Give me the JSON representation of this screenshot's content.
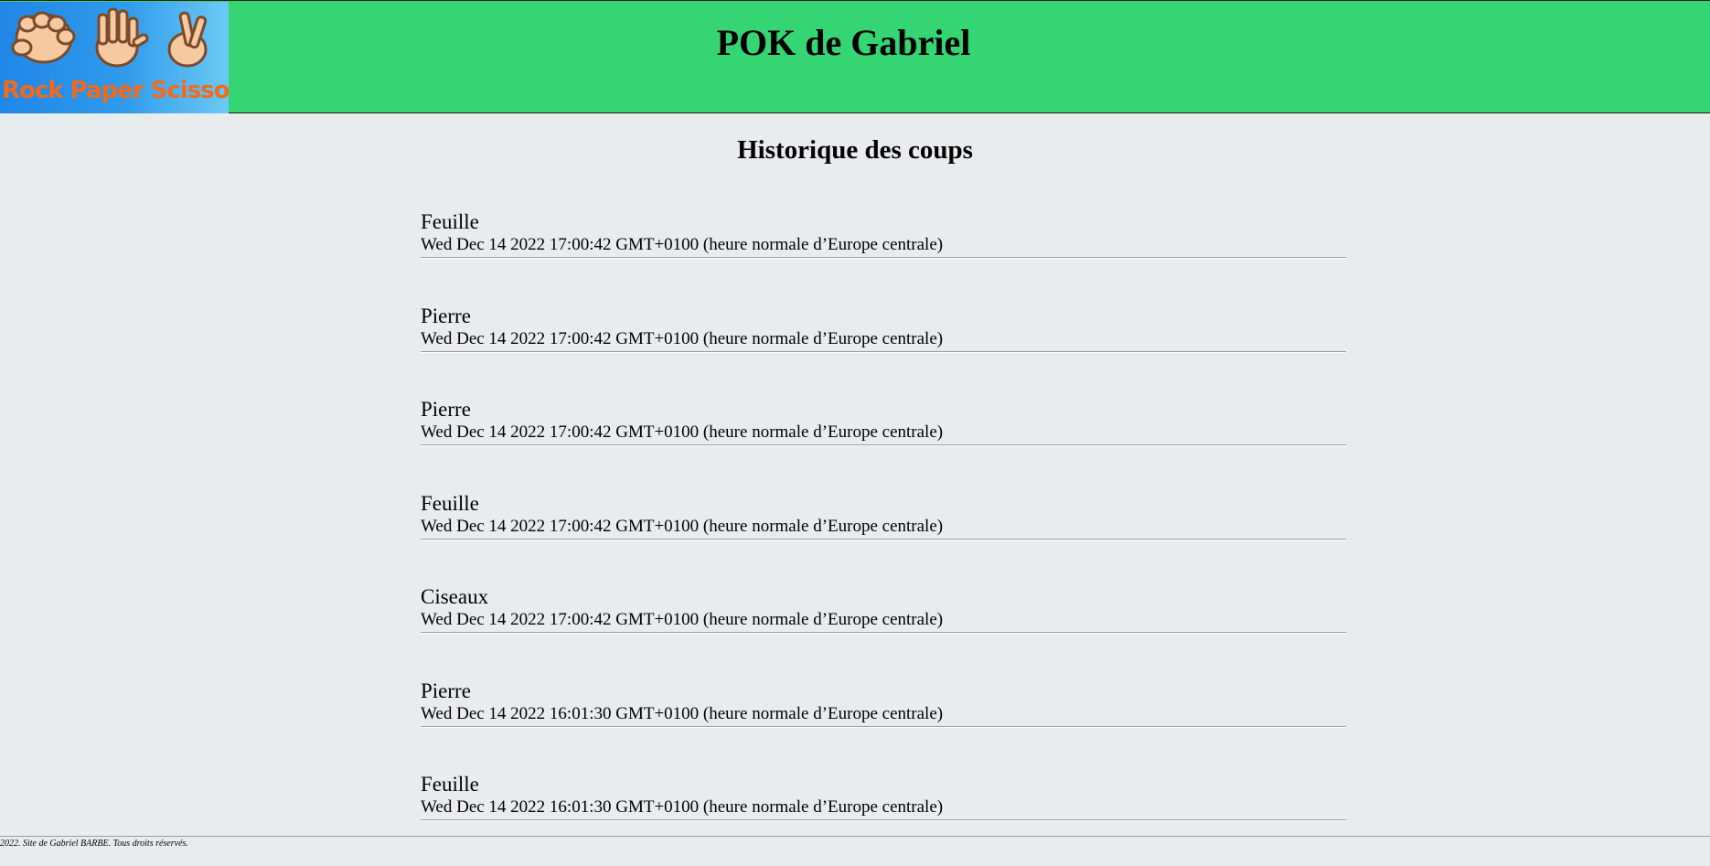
{
  "header": {
    "logo_text": "Rock Paper Scissor",
    "title": "POK de Gabriel"
  },
  "main": {
    "heading": "Historique des coups",
    "history": [
      {
        "move": "Feuille",
        "date": "Wed Dec 14 2022 17:00:42 GMT+0100 (heure normale d’Europe centrale)"
      },
      {
        "move": "Pierre",
        "date": "Wed Dec 14 2022 17:00:42 GMT+0100 (heure normale d’Europe centrale)"
      },
      {
        "move": "Pierre",
        "date": "Wed Dec 14 2022 17:00:42 GMT+0100 (heure normale d’Europe centrale)"
      },
      {
        "move": "Feuille",
        "date": "Wed Dec 14 2022 17:00:42 GMT+0100 (heure normale d’Europe centrale)"
      },
      {
        "move": "Ciseaux",
        "date": "Wed Dec 14 2022 17:00:42 GMT+0100 (heure normale d’Europe centrale)"
      },
      {
        "move": "Pierre",
        "date": "Wed Dec 14 2022 16:01:30 GMT+0100 (heure normale d’Europe centrale)"
      },
      {
        "move": "Feuille",
        "date": "Wed Dec 14 2022 16:01:30 GMT+0100 (heure normale d’Europe centrale)"
      }
    ]
  },
  "footer": {
    "text": "2022. Site de Gabriel BARBE. Tous droits réservés."
  },
  "colors": {
    "header_bg": "#35d573",
    "page_bg": "#e8ecef",
    "logo_text": "#f26a1b"
  }
}
